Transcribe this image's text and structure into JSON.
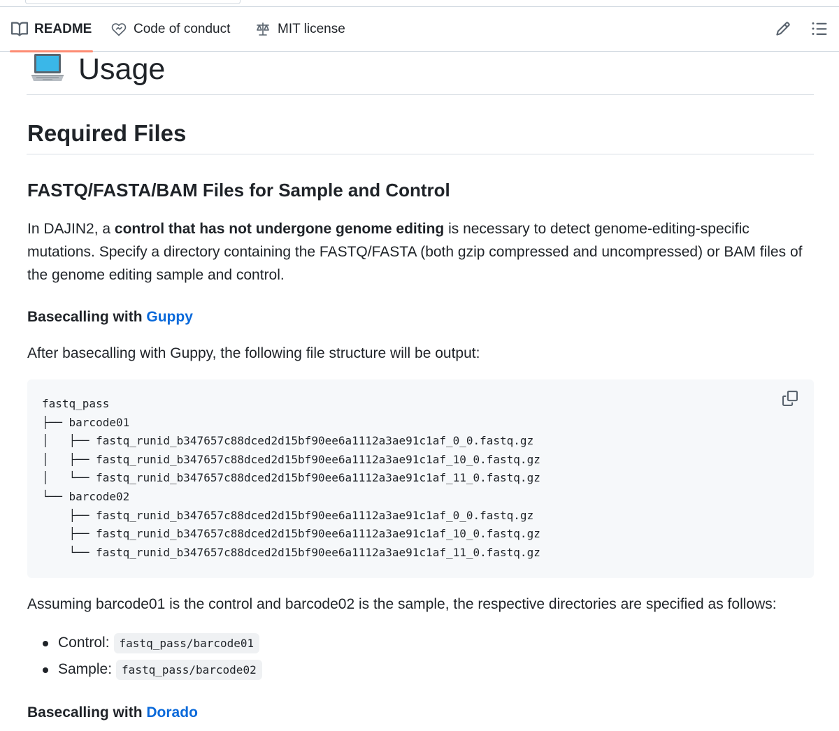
{
  "tabs": [
    {
      "label": "README",
      "icon": "book-icon",
      "active": true
    },
    {
      "label": "Code of conduct",
      "icon": "code-of-conduct-icon",
      "active": false
    },
    {
      "label": "MIT license",
      "icon": "law-scale-icon",
      "active": false
    }
  ],
  "toolbar": {
    "edit_icon": "pencil-icon",
    "outline_icon": "list-unordered-icon"
  },
  "readme": {
    "usage_heading": "Usage",
    "usage_icon": "laptop-emoji-icon",
    "required_files_heading": "Required Files",
    "fastq_heading": "FASTQ/FASTA/BAM Files for Sample and Control",
    "intro": {
      "prefix": "In DAJIN2, a ",
      "bold": "control that has not undergone genome editing",
      "suffix": " is necessary to detect genome-editing-specific mutations. Specify a directory containing the FASTQ/FASTA (both gzip compressed and uncompressed) or BAM files of the genome editing sample and control."
    },
    "guppy_heading": {
      "prefix": "Basecalling with ",
      "link": "Guppy"
    },
    "guppy_text": "After basecalling with Guppy, the following file structure will be output:",
    "code_block": "fastq_pass\n├── barcode01\n│   ├── fastq_runid_b347657c88dced2d15bf90ee6a1112a3ae91c1af_0_0.fastq.gz\n│   ├── fastq_runid_b347657c88dced2d15bf90ee6a1112a3ae91c1af_10_0.fastq.gz\n│   └── fastq_runid_b347657c88dced2d15bf90ee6a1112a3ae91c1af_11_0.fastq.gz\n└── barcode02\n    ├── fastq_runid_b347657c88dced2d15bf90ee6a1112a3ae91c1af_0_0.fastq.gz\n    ├── fastq_runid_b347657c88dced2d15bf90ee6a1112a3ae91c1af_10_0.fastq.gz\n    └── fastq_runid_b347657c88dced2d15bf90ee6a1112a3ae91c1af_11_0.fastq.gz",
    "copy_icon": "copy-icon",
    "assuming_text": "Assuming barcode01 is the control and barcode02 is the sample, the respective directories are specified as follows:",
    "list": [
      {
        "label": "Control:",
        "code": "fastq_pass/barcode01"
      },
      {
        "label": "Sample:",
        "code": "fastq_pass/barcode02"
      }
    ],
    "dorado_heading": {
      "prefix": "Basecalling with ",
      "link": "Dorado"
    }
  },
  "colors": {
    "accent_link": "#0969da",
    "active_tab_underline": "#fd8c73",
    "code_bg": "#f6f8fa",
    "border": "#d1d9e0"
  }
}
